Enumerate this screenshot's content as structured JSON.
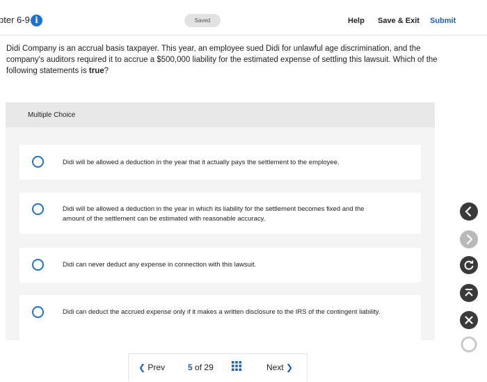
{
  "header": {
    "chapter": "pter 6-9",
    "info_glyph": "i",
    "saved": "Saved",
    "help": "Help",
    "save_exit": "Save & Exit",
    "submit": "Submit"
  },
  "question": {
    "text_before": "Didi Company is an accrual basis taxpayer. This year, an employee sued Didi for unlawful age discrimination, and the company's auditors required it to accrue a $500,000 liability for the estimated expense of settling this lawsuit. Which of the following statements is ",
    "emphasis": "true",
    "text_after": "?"
  },
  "panel": {
    "title": "Multiple Choice",
    "options": [
      {
        "label": "Didi will be allowed a deduction in the year that it actually pays the settlement to the employee."
      },
      {
        "label": "Didi will be allowed a deduction in the year in which its liability for the settlement becomes fixed and the amount of the settlement can be estimated with reasonable accuracy."
      },
      {
        "label": "Didi can never deduct any expense in connection with this lawsuit."
      },
      {
        "label": "Didi can deduct the accrued expense only if it makes a written disclosure to the IRS of the contingent liability."
      }
    ]
  },
  "nav": {
    "prev": "Prev",
    "current": "5",
    "of": "of",
    "total": "29",
    "next": "Next"
  },
  "side_controls": {
    "back_icon": "chevron-left-icon",
    "forward_icon": "chevron-right-icon",
    "refresh_icon": "refresh-icon",
    "top_icon": "scroll-top-icon",
    "close_icon": "close-icon",
    "record_icon": "circle-icon"
  },
  "colors": {
    "accent": "#1a5fb4",
    "radio": "#1e73c9",
    "control_dark": "#3a3a3a",
    "control_light": "#b9b9b9"
  }
}
